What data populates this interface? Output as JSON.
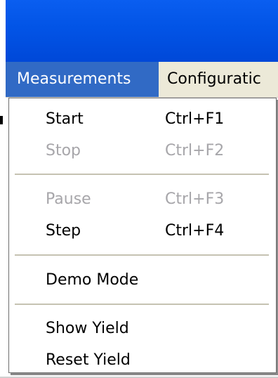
{
  "menu_bar": {
    "items": [
      {
        "label": "Measurements"
      },
      {
        "label": "Configuratic"
      }
    ]
  },
  "dropdown": {
    "items": [
      {
        "label": "Start",
        "shortcut": "Ctrl+F1",
        "enabled": true
      },
      {
        "label": "Stop",
        "shortcut": "Ctrl+F2",
        "enabled": false
      },
      {
        "label": "Pause",
        "shortcut": "Ctrl+F3",
        "enabled": false
      },
      {
        "label": "Step",
        "shortcut": "Ctrl+F4",
        "enabled": true
      },
      {
        "label": "Demo Mode",
        "shortcut": "",
        "enabled": true
      },
      {
        "label": "Show Yield",
        "shortcut": "",
        "enabled": true
      },
      {
        "label": "Reset Yield",
        "shortcut": "",
        "enabled": true
      }
    ]
  },
  "colors": {
    "title_bar": "#0254e6",
    "menu_highlight": "#316ac5",
    "menu_bar": "#ece9d8",
    "disabled_text": "#a7a6aa"
  }
}
